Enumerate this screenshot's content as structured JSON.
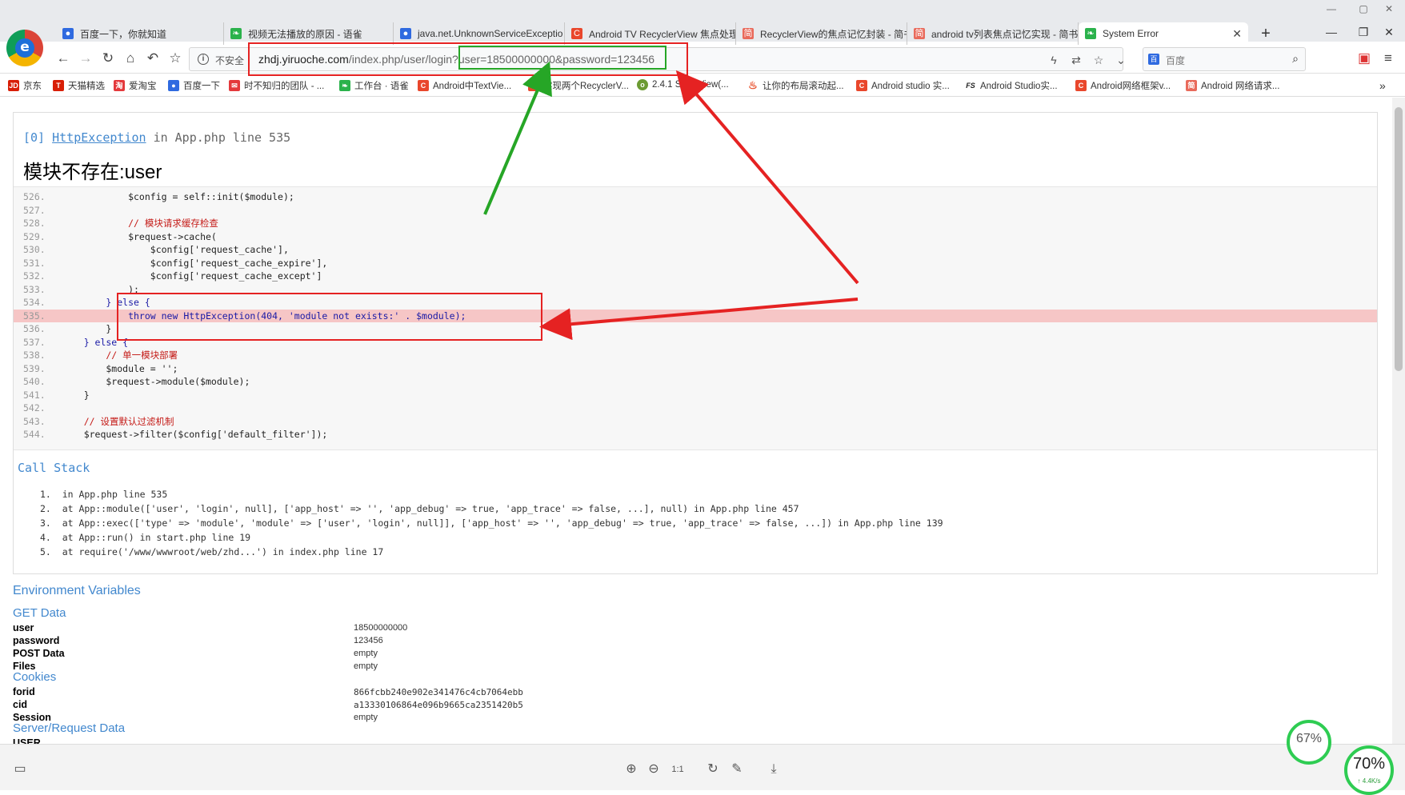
{
  "tabs": [
    {
      "title": "百度一下，你就知道",
      "icon": "paw-icon",
      "color": "#2f6ae0"
    },
    {
      "title": "视频无法播放的原因 - 语雀",
      "icon": "leaf-icon",
      "color": "#2bb24c"
    },
    {
      "title": "java.net.UnknownServiceExceptio",
      "icon": "paw-icon",
      "color": "#2f6ae0"
    },
    {
      "title": "Android TV RecyclerView 焦点处理",
      "icon": "c-icon",
      "color": "#e9472c"
    },
    {
      "title": "RecyclerView的焦点记忆封装 - 简书",
      "icon": "jian-icon",
      "color": "#e96a5b"
    },
    {
      "title": "android tv列表焦点记忆实现 - 简书",
      "icon": "jian-icon",
      "color": "#e96a5b"
    },
    {
      "title": "System Error",
      "icon": "leaf-icon",
      "color": "#2bb24c",
      "active": true
    }
  ],
  "address": {
    "security": "不安全",
    "host": "zhdj.yiruoche.com",
    "path": "/index.php/user/login?",
    "query": "user=18500000000&password=123456"
  },
  "search": {
    "placeholder": "百度"
  },
  "bookmarks": [
    {
      "label": "京东",
      "icon": "JD",
      "color": "#d81e06"
    },
    {
      "label": "天猫精选",
      "icon": "T",
      "color": "#d81e06"
    },
    {
      "label": "爱淘宝",
      "icon": "淘",
      "color": "#e4393c"
    },
    {
      "label": "百度一下",
      "icon": "paw",
      "color": "#2f6ae0"
    },
    {
      "label": "时不知归的团队 - ...",
      "icon": "mail",
      "color": "#e4393c"
    },
    {
      "label": "工作台 · 语雀",
      "icon": "leaf",
      "color": "#2bb24c"
    },
    {
      "label": "Android中TextVie...",
      "icon": "C",
      "color": "#e9472c"
    },
    {
      "label": "实现两个RecyclerV...",
      "icon": "C",
      "color": "#e9472c"
    },
    {
      "label": "2.4.1 ScrollView(...",
      "icon": "o",
      "color": "#6c9b33"
    },
    {
      "label": "让你的布局滚动起...",
      "icon": "flame",
      "color": "#e84f2a"
    },
    {
      "label": "Android studio 实...",
      "icon": "C",
      "color": "#e9472c"
    },
    {
      "label": "Android Studio实...",
      "icon": "FS",
      "color": "#222222"
    },
    {
      "label": "Android网络框架v...",
      "icon": "C",
      "color": "#e9472c"
    },
    {
      "label": "Android 网络请求...",
      "icon": "简",
      "color": "#e96a5b"
    }
  ],
  "error": {
    "index": "[0]",
    "exception": "HttpException",
    "location": "in App.php line 535",
    "message": "模块不存在:user"
  },
  "code_lines": [
    {
      "n": "526.",
      "code": "            $config = self::init($module);"
    },
    {
      "n": "527.",
      "code": ""
    },
    {
      "n": "528.",
      "code": "            // 模块请求缓存检查"
    },
    {
      "n": "529.",
      "code": "            $request->cache("
    },
    {
      "n": "530.",
      "code": "                $config['request_cache'],"
    },
    {
      "n": "531.",
      "code": "                $config['request_cache_expire'],"
    },
    {
      "n": "532.",
      "code": "                $config['request_cache_except']"
    },
    {
      "n": "533.",
      "code": "            );"
    },
    {
      "n": "534.",
      "code": "        } else {"
    },
    {
      "n": "535.",
      "code": "            throw new HttpException(404, 'module not exists:' . $module);"
    },
    {
      "n": "536.",
      "code": "        }"
    },
    {
      "n": "537.",
      "code": "    } else {"
    },
    {
      "n": "538.",
      "code": "        // 单一模块部署"
    },
    {
      "n": "539.",
      "code": "        $module = '';"
    },
    {
      "n": "540.",
      "code": "        $request->module($module);"
    },
    {
      "n": "541.",
      "code": "    }"
    },
    {
      "n": "542.",
      "code": ""
    },
    {
      "n": "543.",
      "code": "    // 设置默认过滤机制"
    },
    {
      "n": "544.",
      "code": "    $request->filter($config['default_filter']);"
    }
  ],
  "call_stack_title": "Call Stack",
  "call_stack": [
    "1.  in App.php line 535",
    "2.  at App::module(['user', 'login', null], ['app_host' => '', 'app_debug' => true, 'app_trace' => false, ...], null) in App.php line 457",
    "3.  at App::exec(['type' => 'module', 'module' => ['user', 'login', null]], ['app_host' => '', 'app_debug' => true, 'app_trace' => false, ...]) in App.php line 139",
    "4.  at App::run() in start.php line 19",
    "5.  at require('/www/wwwroot/web/zhd...') in index.php line 17"
  ],
  "env": {
    "title": "Environment Variables",
    "get_title": "GET Data",
    "get": [
      {
        "k": "user",
        "v": "18500000000"
      },
      {
        "k": "password",
        "v": "123456"
      }
    ],
    "post": {
      "k": "POST Data",
      "v": "empty"
    },
    "files": {
      "k": "Files",
      "v": "empty"
    },
    "cookies_title": "Cookies",
    "cookies": [
      {
        "k": "forid",
        "v": "866fcbb240e902e341476c4cb7064ebb"
      },
      {
        "k": "cid",
        "v": "a13330106864e096b9665ca2351420b5"
      }
    ],
    "session": {
      "k": "Session",
      "v": "empty"
    },
    "server_title": "Server/Request Data",
    "server_first": "USER"
  },
  "status": {
    "main_pct": "70%",
    "speed": "↑ 4.4K/s",
    "back_pct": "67%"
  },
  "colors": {
    "accent_blue": "#4288ce",
    "annotation_red": "#e52222",
    "annotation_green": "#26a626",
    "highlight_row": "#f6c6c6"
  }
}
